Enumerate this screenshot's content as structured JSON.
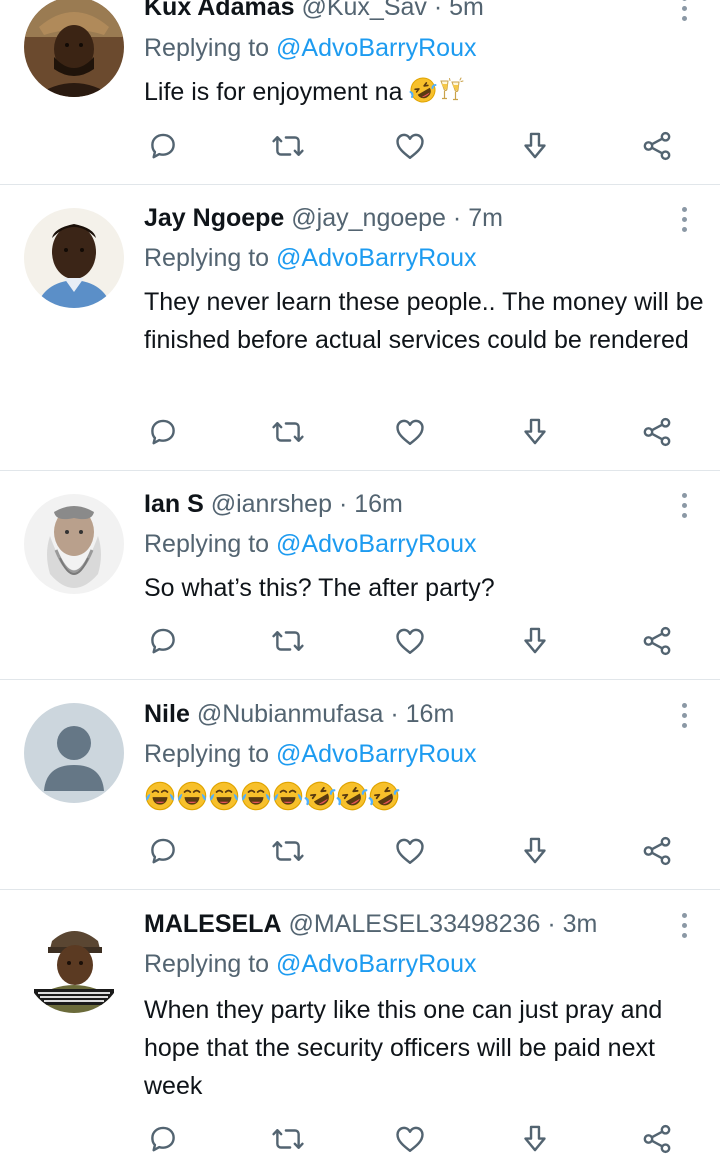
{
  "replying_prefix": "Replying to",
  "tweets": [
    {
      "name": "Kux Adamas",
      "handle": "@Kux_Sav",
      "time": "5m",
      "reply_to": "@AdvoBarryRoux",
      "text": "Life is for enjoyment na",
      "emoji": [
        "rolling-on-floor-laughing",
        "clinking-glasses"
      ]
    },
    {
      "name": "Jay Ngoepe",
      "handle": "@jay_ngoepe",
      "time": "7m",
      "reply_to": "@AdvoBarryRoux",
      "text": "They never learn these people.. The money will be finished before actual services could be rendered"
    },
    {
      "name": "Ian S",
      "handle": "@ianrshep",
      "time": "16m",
      "reply_to": "@AdvoBarryRoux",
      "text": "So what’s this? The after party?"
    },
    {
      "name": "Nile",
      "handle": "@Nubianmufasa",
      "time": "16m",
      "reply_to": "@AdvoBarryRoux",
      "text": "",
      "emoji": [
        "face-with-tears-of-joy",
        "face-with-tears-of-joy",
        "face-with-tears-of-joy",
        "face-with-tears-of-joy",
        "face-with-tears-of-joy",
        "rolling-on-floor-laughing",
        "rolling-on-floor-laughing",
        "rolling-on-floor-laughing"
      ]
    },
    {
      "name": "MALESELA",
      "handle": "@MALESEL33498236",
      "time": "3m",
      "reply_to": "@AdvoBarryRoux",
      "text": "When they party like this one can just pray and hope that the security officers will be paid next week"
    }
  ],
  "actions": [
    "reply-icon",
    "retweet-icon",
    "like-icon",
    "download-icon",
    "share-icon"
  ],
  "colors": {
    "mention": "#1d9bf0",
    "secondary_text": "#536471",
    "icon": "#536471",
    "divider": "#e1e6ea",
    "emoji_yellow": "#f7c02b",
    "emoji_tears": "#4fb0ff"
  }
}
